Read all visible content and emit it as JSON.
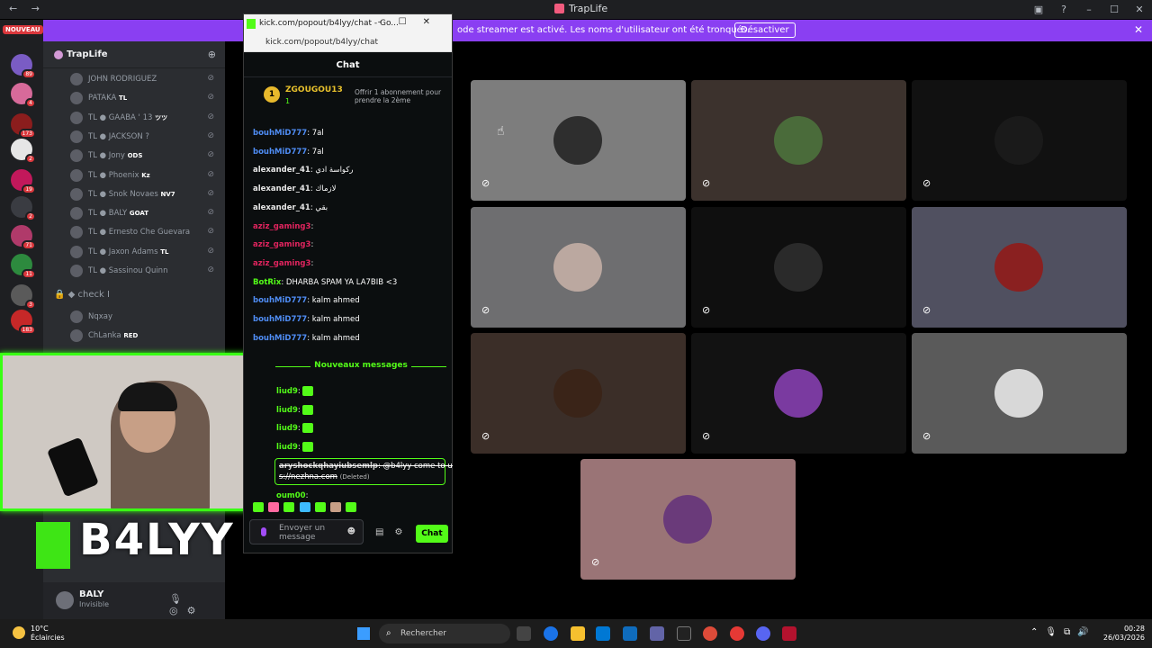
{
  "window": {
    "app_title": "TrapLife",
    "nav": "← →"
  },
  "banner": {
    "text": "ode streamer est activé. Les noms d'utilisateur ont été tronqués.",
    "button": "Désactiver"
  },
  "servers": {
    "new_badge": "NOUVEAU",
    "counts": [
      "89",
      "4",
      "173",
      "2",
      "19",
      "2",
      "71",
      "11",
      "3",
      "183"
    ]
  },
  "sidebar": {
    "server_name": "TrapLife",
    "voice_users": [
      {
        "name": "JOHN RODRIGUEZ",
        "badge": ""
      },
      {
        "name": "PATAKA",
        "badge": "TL"
      },
      {
        "name": "TL ● GAABA ' 13",
        "badge": "ツツ"
      },
      {
        "name": "TL ● JACKSON ?",
        "badge": ""
      },
      {
        "name": "TL ● Jony",
        "badge": "ODS"
      },
      {
        "name": "TL ● Phoenix",
        "badge": "Kz"
      },
      {
        "name": "TL ● Snok Novaes",
        "badge": "NV7"
      },
      {
        "name": "TL ● BALY",
        "badge": "GOAT"
      },
      {
        "name": "TL ● Ernesto Che Guevara",
        "badge": ""
      },
      {
        "name": "TL ● Jaxon Adams",
        "badge": "TL"
      },
      {
        "name": "TL ● Sassinou Quinn",
        "badge": ""
      }
    ],
    "channel_locked": "check I",
    "channel_users": [
      {
        "name": "Nqxay",
        "badge": ""
      },
      {
        "name": "ChLanka",
        "badge": "RED"
      }
    ]
  },
  "user": {
    "name": "BALY",
    "status": "Invisible"
  },
  "overlay": {
    "logo_text": "B4LYY"
  },
  "popup": {
    "window_title": "kick.com/popout/b4lyy/chat - Go...",
    "url": "kick.com/popout/b4lyy/chat",
    "chat_title": "Chat",
    "pinned": {
      "rank": "1",
      "user": "ZGOUGOU13",
      "count": "1",
      "gift_text": "Offrir 1 abonnement pour prendre la 2ème"
    },
    "messages": [
      {
        "user": "bouhMiD777",
        "text": ": 7al",
        "color": "#4f8df5"
      },
      {
        "user": "bouhMiD777",
        "text": ": 7al",
        "color": "#4f8df5"
      },
      {
        "user": "alexander_41",
        "text": ": ركواسة ادي",
        "color": "#e6e6e6"
      },
      {
        "user": "alexander_41",
        "text": ": لازماك",
        "color": "#e6e6e6"
      },
      {
        "user": "alexander_41",
        "text": ": بقي",
        "color": "#e6e6e6"
      },
      {
        "user": "aziz_gaming3",
        "text": ":",
        "color": "#e0245e"
      },
      {
        "user": "aziz_gaming3",
        "text": ":",
        "color": "#e0245e"
      },
      {
        "user": "aziz_gaming3",
        "text": ":",
        "color": "#e0245e"
      },
      {
        "user": "BotRix",
        "text": ": DHARBA SPAM YA LA7BIB <3",
        "color": "#53fc18"
      },
      {
        "user": "bouhMiD777",
        "text": ": kalm ahmed",
        "color": "#4f8df5"
      },
      {
        "user": "bouhMiD777",
        "text": ": kalm ahmed",
        "color": "#4f8df5"
      },
      {
        "user": "bouhMiD777",
        "text": ": kalm ahmed",
        "color": "#4f8df5"
      }
    ],
    "new_messages": "Nouveaux messages",
    "messages2": [
      {
        "user": "liud9",
        "text": ":",
        "color": "#53fc18"
      },
      {
        "user": "liud9",
        "text": ":",
        "color": "#53fc18"
      },
      {
        "user": "liud9",
        "text": ":",
        "color": "#53fc18"
      },
      {
        "user": "liud9",
        "text": ":",
        "color": "#53fc18"
      }
    ],
    "deleted": {
      "user": "aryshockqhayiubsemlp",
      "text": ": @b4lyy come to us",
      "line2": "s://nezhna.com",
      "tag": "(Deleted)"
    },
    "last": {
      "user": "oum00",
      "text": ":"
    },
    "input_placeholder": "Envoyer un message",
    "send_label": "Chat"
  },
  "tiles": [
    {
      "bg": "#7d7d7d",
      "avatar": "#2e2e2e"
    },
    {
      "bg": "#3c322d",
      "avatar": "#4a6b3a"
    },
    {
      "bg": "#111111",
      "avatar": "#1a1a1a"
    },
    {
      "bg": "#6e6e70",
      "avatar": "#bba8a0"
    },
    {
      "bg": "#0f0f0f",
      "avatar": "#2a2a2a"
    },
    {
      "bg": "#505060",
      "avatar": "#8a2020"
    },
    {
      "bg": "#3b2e28",
      "avatar": "#3a2418"
    },
    {
      "bg": "#121212",
      "avatar": "#7a3aa0"
    },
    {
      "bg": "#5a5a5a",
      "avatar": "#d8d8d8"
    },
    {
      "bg": "#9a7476",
      "avatar": "#6a3a7a"
    }
  ],
  "taskbar": {
    "temp": "10°C",
    "weather": "Éclaircies",
    "search": "Rechercher",
    "time": "00:28",
    "date": "26/03/2026"
  }
}
